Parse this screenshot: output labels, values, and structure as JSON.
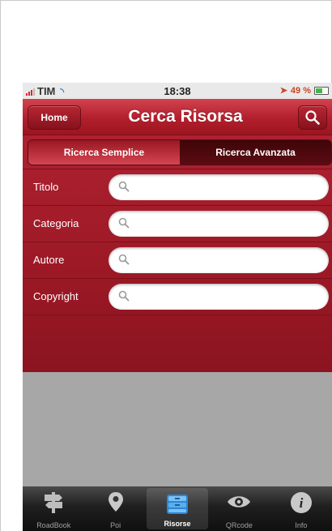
{
  "status_bar": {
    "carrier": "TIM",
    "time": "18:38",
    "battery": "49 %"
  },
  "navbar": {
    "home_label": "Home",
    "title": "Cerca Risorsa"
  },
  "segments": [
    {
      "label": "Ricerca Semplice",
      "selected": true
    },
    {
      "label": "Ricerca Avanzata",
      "selected": false
    }
  ],
  "fields": [
    {
      "label": "Titolo",
      "value": ""
    },
    {
      "label": "Categoria",
      "value": ""
    },
    {
      "label": "Autore",
      "value": ""
    },
    {
      "label": "Copyright",
      "value": ""
    }
  ],
  "tabs": [
    {
      "label": "RoadBook",
      "icon": "signpost-icon",
      "active": false
    },
    {
      "label": "Poi",
      "icon": "map-pin-icon",
      "active": false
    },
    {
      "label": "Risorse",
      "icon": "cabinet-icon",
      "active": true
    },
    {
      "label": "QRcode",
      "icon": "eye-icon",
      "active": false
    },
    {
      "label": "Info",
      "icon": "info-icon",
      "active": false
    }
  ],
  "colors": {
    "brand_red": "#b21f2c",
    "tab_bar": "#1f1f1f",
    "active_tab_icon": "#2a86d8"
  }
}
